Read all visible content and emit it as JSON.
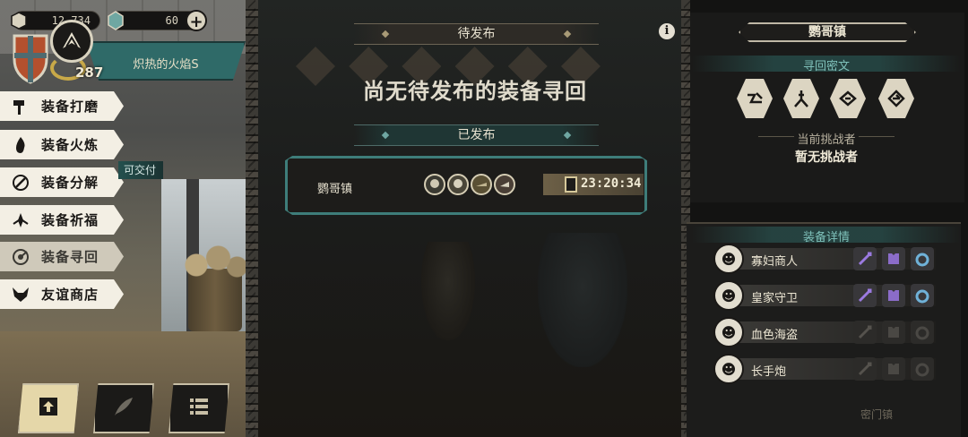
{
  "currency": {
    "gold": {
      "value": "12,734",
      "icon": "coin-icon"
    },
    "gems": {
      "value": "60",
      "icon": "gem-icon"
    }
  },
  "player": {
    "level": "287",
    "title": "炽热的火焰S"
  },
  "menu": {
    "items": [
      {
        "label": "装备打磨",
        "icon": "hammer-icon"
      },
      {
        "label": "装备火炼",
        "icon": "flame-icon"
      },
      {
        "label": "装备分解",
        "icon": "disassemble-icon"
      },
      {
        "label": "装备祈福",
        "icon": "prayer-icon"
      },
      {
        "label": "装备寻回",
        "icon": "retrieve-icon"
      },
      {
        "label": "友谊商店",
        "icon": "fox-shop-icon"
      }
    ],
    "active_index": 4,
    "deliverable_badge": "可交付"
  },
  "center": {
    "pending_header": "待发布",
    "empty_message": "尚无待发布的装备寻回",
    "posted_header": "已发布",
    "info_label": "i",
    "posted": [
      {
        "location": "鹦哥镇",
        "timer": "23:20:34",
        "heroes": 4
      }
    ]
  },
  "right": {
    "location": "鹦哥镇",
    "secret_label": "寻回密文",
    "secret_icons": [
      "rune-a-icon",
      "rune-b-icon",
      "rune-c-icon",
      "rune-d-icon"
    ],
    "challenger_label": "当前挑战者",
    "challenger_value": "暂无挑战者",
    "detail_label": "装备详情",
    "details": [
      {
        "name": "寡妇商人",
        "owned": [
          true,
          true,
          true
        ]
      },
      {
        "name": "皇家守卫",
        "owned": [
          true,
          true,
          true
        ]
      },
      {
        "name": "血色海盗",
        "owned": [
          false,
          false,
          false
        ]
      },
      {
        "name": "长手炮",
        "owned": [
          false,
          false,
          false
        ]
      }
    ],
    "ghost_text": "密门镇"
  },
  "colors": {
    "teal": "#3e7d7a",
    "cream": "#f3efe4",
    "gold": "#c8a948",
    "purple": "#8b6cc9",
    "blue": "#6fb1d8"
  }
}
